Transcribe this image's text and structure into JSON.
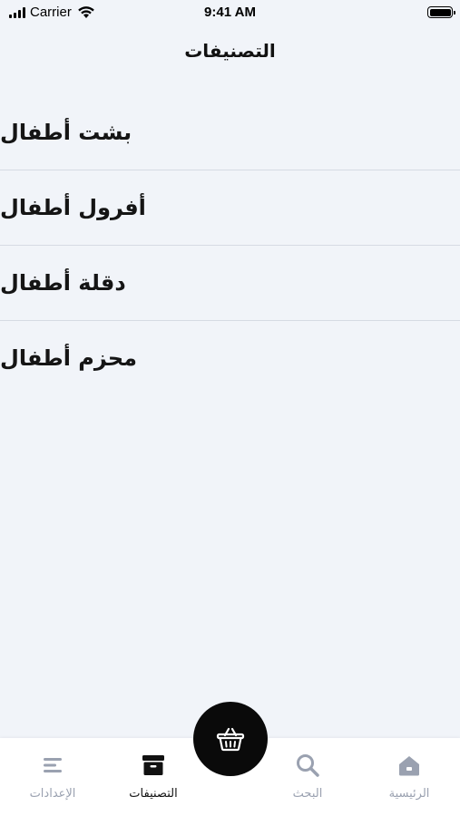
{
  "status_bar": {
    "carrier": "Carrier",
    "time": "9:41 AM"
  },
  "header": {
    "title": "التصنيفات"
  },
  "categories": [
    {
      "label": "بشت أطفال"
    },
    {
      "label": "أفرول أطفال"
    },
    {
      "label": "دقلة أطفال"
    },
    {
      "label": "محزم أطفال"
    }
  ],
  "tab_bar": {
    "items": [
      {
        "label": "الإعدادات",
        "icon": "menu-icon",
        "active": false
      },
      {
        "label": "التصنيفات",
        "icon": "archive-box-icon",
        "active": true
      },
      {
        "label": "البحث",
        "icon": "search-icon",
        "active": false
      },
      {
        "label": "الرئيسية",
        "icon": "home-icon",
        "active": false
      }
    ],
    "cart_button": {
      "icon": "basket-icon"
    }
  },
  "colors": {
    "background": "#f1f4f9",
    "tab_inactive": "#9aa1b0",
    "tab_active": "#111111",
    "fab": "#0a0a0a"
  }
}
